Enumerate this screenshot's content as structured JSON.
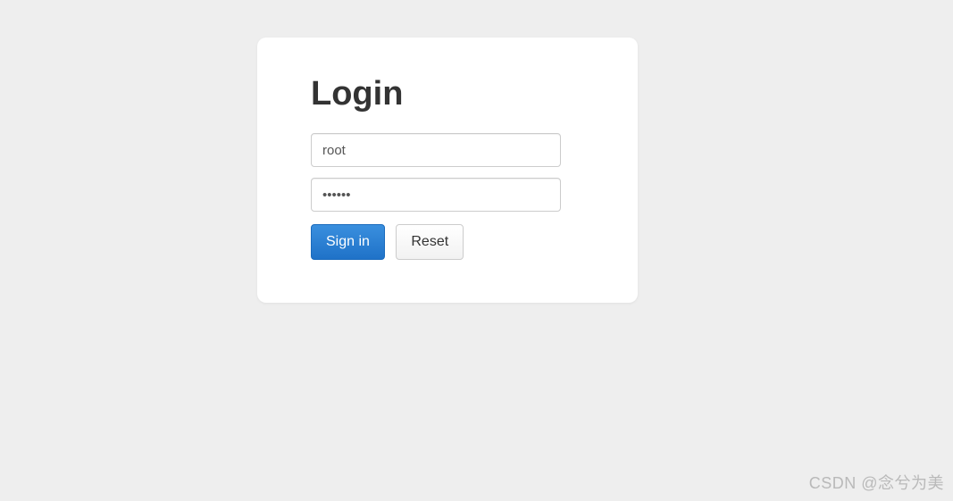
{
  "login": {
    "title": "Login",
    "username_value": "root",
    "password_value": "••••••",
    "signin_label": "Sign in",
    "reset_label": "Reset"
  },
  "watermark": "CSDN @念兮为美"
}
